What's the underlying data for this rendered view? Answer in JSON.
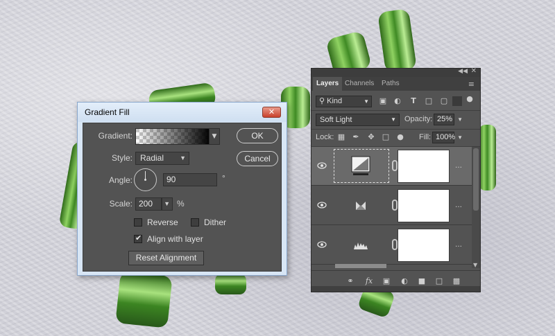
{
  "dialog": {
    "title": "Gradient Fill",
    "close_glyph": "✕",
    "gradient_label": "Gradient:",
    "style_label": "Style:",
    "style_value": "Radial",
    "angle_label": "Angle:",
    "angle_value": "90",
    "angle_unit": "°",
    "scale_label": "Scale:",
    "scale_value": "200",
    "scale_unit": "%",
    "reverse_label": "Reverse",
    "reverse_checked": false,
    "dither_label": "Dither",
    "dither_checked": false,
    "align_label": "Align with layer",
    "align_checked": true,
    "reset_label": "Reset Alignment",
    "ok_label": "OK",
    "cancel_label": "Cancel"
  },
  "layers_panel": {
    "tabs": [
      "Layers",
      "Channels",
      "Paths"
    ],
    "active_tab": "Layers",
    "filter_kind": "Kind",
    "blend_mode": "Soft Light",
    "opacity_label": "Opacity:",
    "opacity_value": "25%",
    "lock_label": "Lock:",
    "fill_label": "Fill:",
    "fill_value": "100%",
    "layers": [
      {
        "type": "gradient-fill",
        "selected": true,
        "visible": true
      },
      {
        "type": "gradient-map",
        "selected": false,
        "visible": true
      },
      {
        "type": "levels",
        "selected": false,
        "visible": true
      }
    ],
    "footer_icons": [
      "link-icon",
      "fx-icon",
      "mask-icon",
      "adjustment-icon",
      "folder-icon",
      "new-layer-icon",
      "trash-icon"
    ]
  },
  "colors": {
    "panel_bg": "#535353",
    "dialog_frame": "#d8e6f5",
    "close_red": "#c8402c",
    "cactus_green": "#4f9a2e"
  }
}
